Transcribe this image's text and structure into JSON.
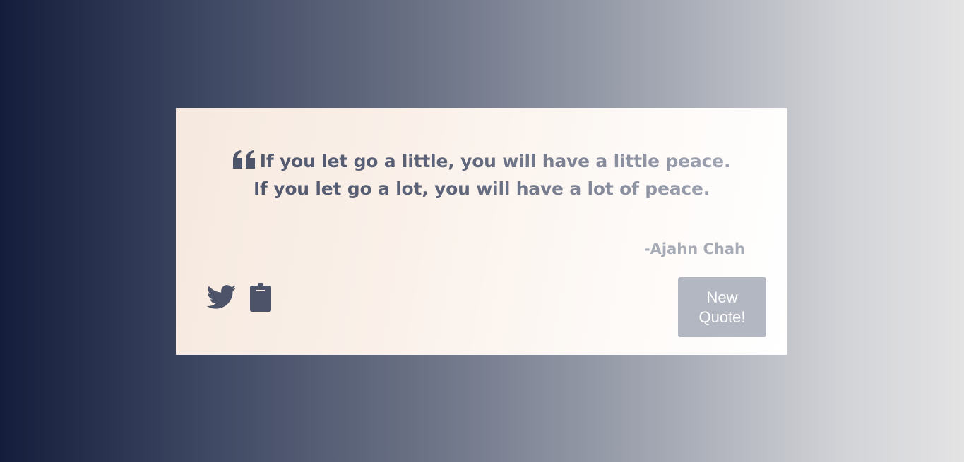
{
  "quote": {
    "line1": "If you let go a little, you will have a little peace.",
    "line2": "If you let go a lot, you will have a lot of peace.",
    "icon": "quote-left-icon"
  },
  "author": {
    "text": "-Ajahn Chah"
  },
  "actions": {
    "twitter_icon": "twitter-icon",
    "clipboard_icon": "clipboard-icon",
    "new_quote_label": "New Quote!"
  },
  "colors": {
    "icon": "#4d5469",
    "button_bg": "#b3b7c2",
    "author": "#a8acb7"
  }
}
